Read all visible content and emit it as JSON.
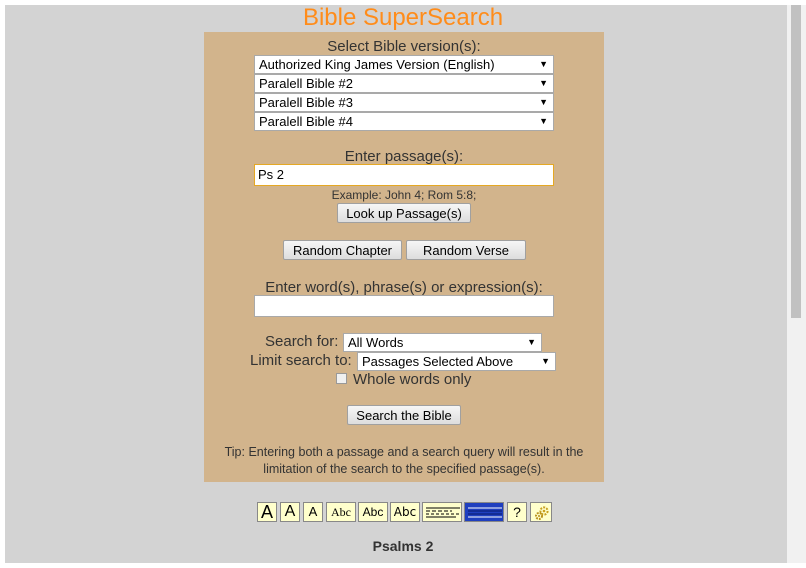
{
  "app": {
    "title": "Bible SuperSearch"
  },
  "versions": {
    "label": "Select Bible version(s):",
    "selected": [
      "Authorized King James Version (English)",
      "Paralell Bible #2",
      "Paralell Bible #3",
      "Paralell Bible #4"
    ]
  },
  "passage": {
    "label": "Enter passage(s):",
    "value": "Ps 2",
    "example": "Example: John 4; Rom 5:8;",
    "lookup_button": "Look up Passage(s)"
  },
  "random": {
    "chapter_button": "Random Chapter",
    "verse_button": "Random Verse"
  },
  "search": {
    "label": "Enter word(s), phrase(s) or expression(s):",
    "value": "",
    "search_for_label": "Search for:",
    "search_for_value": "All Words",
    "limit_label": "Limit search to:",
    "limit_value": "Passages Selected Above",
    "whole_words_label": "Whole words only",
    "whole_words_checked": false,
    "submit_button": "Search the Bible",
    "tip_line1": "Tip: Entering both a passage and a search query will result in the",
    "tip_line2": "limitation of the search to the specified passage(s)."
  },
  "toolbar": {
    "font_large": "A",
    "font_medium": "A",
    "font_small": "A",
    "style_serif": "Abc",
    "style_sans": "Abc",
    "style_mono": "Abc",
    "help": "?"
  },
  "result": {
    "title": "Psalms 2"
  },
  "colors": {
    "title": "#ff8c1a",
    "panel": "#d2b48c",
    "page": "#d3d3d3",
    "toolbar_button": "#ffffcc"
  }
}
